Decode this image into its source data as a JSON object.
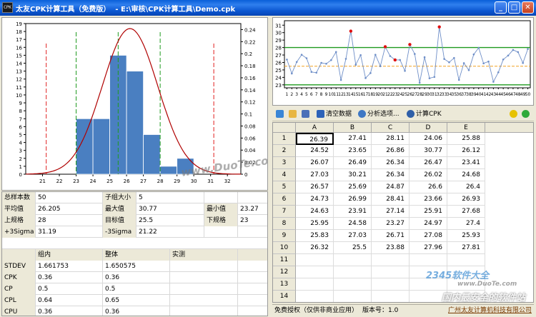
{
  "window": {
    "icon_text": "CPK",
    "title": "太友CPK计算工具（免费版）  - E:\\审核\\CPK计算工具\\Demo.cpk",
    "min": "_",
    "max": "□",
    "close": "✕"
  },
  "histogram": {
    "y_left_ticks": [
      "0",
      "1",
      "2",
      "3",
      "4",
      "5",
      "6",
      "7",
      "8",
      "9",
      "10",
      "11",
      "12",
      "13",
      "14",
      "15",
      "16",
      "17",
      "18",
      "19"
    ],
    "y_right_ticks": [
      "0",
      "0.02",
      "0.04",
      "0.06",
      "0.08",
      "0.1",
      "0.12",
      "0.14",
      "0.16",
      "0.18",
      "0.2",
      "0.22",
      "0.24"
    ],
    "x_ticks": [
      "21",
      "22",
      "23",
      "24",
      "25",
      "26",
      "27",
      "28",
      "29",
      "30",
      "31",
      "32"
    ],
    "watermark": "www.DuoTe.com"
  },
  "control_chart": {
    "y_ticks": [
      "23",
      "24",
      "25",
      "26",
      "27",
      "28",
      "29",
      "30",
      "31"
    ],
    "x_ticks": [
      "1",
      "2",
      "3",
      "4",
      "5",
      "6",
      "7",
      "8",
      "9",
      "10",
      "11",
      "12",
      "13",
      "14",
      "15",
      "16",
      "17",
      "18",
      "19",
      "20",
      "21",
      "22",
      "23",
      "24",
      "25",
      "26",
      "27",
      "28",
      "29",
      "30",
      "31",
      "32",
      "33",
      "34",
      "35",
      "36",
      "37",
      "38",
      "39",
      "40",
      "41",
      "42",
      "43",
      "44",
      "45",
      "46",
      "47",
      "48",
      "49",
      "50"
    ]
  },
  "chart_data": [
    {
      "type": "bar",
      "categories": [
        "23-24",
        "24-25",
        "25-26",
        "26-27",
        "27-28",
        "28-29",
        "29-30",
        "30-31"
      ],
      "values": [
        7,
        7,
        15,
        13,
        5,
        1,
        2,
        0
      ],
      "title": "",
      "xlabel": "",
      "ylabel": "",
      "ylim": [
        0,
        19
      ],
      "y2lim": [
        0,
        0.25
      ],
      "lsl": 21.22,
      "usl": 31.19,
      "spec_lines": [
        23,
        25.5,
        28
      ],
      "mean": 26.205,
      "stdev": 1.650575,
      "xlim": [
        20,
        32.8
      ]
    },
    {
      "type": "line",
      "x": [
        1,
        2,
        3,
        4,
        5,
        6,
        7,
        8,
        9,
        10,
        11,
        12,
        13,
        14,
        15,
        16,
        17,
        18,
        19,
        20,
        21,
        22,
        23,
        24,
        25,
        26,
        27,
        28,
        29,
        30,
        31,
        32,
        33,
        34,
        35,
        36,
        37,
        38,
        39,
        40,
        41,
        42,
        43,
        44,
        45,
        46,
        47,
        48,
        49,
        50
      ],
      "values": [
        26.39,
        24.52,
        26.07,
        27.03,
        26.57,
        24.73,
        24.63,
        25.95,
        25.83,
        26.32,
        27.41,
        23.65,
        26.49,
        30.21,
        25.69,
        26.99,
        23.91,
        24.58,
        27.03,
        25.5,
        28.11,
        26.86,
        26.34,
        26.34,
        24.87,
        28.41,
        27.14,
        23.27,
        26.71,
        23.88,
        24.06,
        30.77,
        26.47,
        26.02,
        26.6,
        23.66,
        25.91,
        24.97,
        27.08,
        27.96,
        25.88,
        26.12,
        23.41,
        24.68,
        26.4,
        26.93,
        27.68,
        27.4,
        25.93,
        27.81
      ],
      "ylim": [
        22.6,
        31.6
      ],
      "usl": 28,
      "lsl": 23,
      "center": 25.5,
      "highlight_points": [
        14,
        21,
        23,
        26,
        32
      ]
    }
  ],
  "stats": {
    "row1": [
      "总样本数",
      "50",
      "子组大小",
      "5"
    ],
    "row2": [
      "平均值",
      "26.205",
      "最大值",
      "30.77",
      "最小值",
      "23.27"
    ],
    "row3": [
      "上规格",
      "28",
      "目标值",
      "25.5",
      "下规格",
      "23"
    ],
    "row4": [
      "+3Sigma",
      "31.19",
      "-3Sigma",
      "21.22"
    ],
    "cap_header": [
      "",
      "组内",
      "整体",
      "实测"
    ],
    "cap_rows": [
      [
        "STDEV",
        "1.661753",
        "1.650575",
        ""
      ],
      [
        "CPK",
        "0.36",
        "0.36",
        ""
      ],
      [
        "CP",
        "0.5",
        "0.5",
        ""
      ],
      [
        "CPL",
        "0.64",
        "0.65",
        ""
      ],
      [
        "CPU",
        "0.36",
        "0.36",
        ""
      ]
    ]
  },
  "toolbar": {
    "clear": "清空数据",
    "options": "分析选项...",
    "calc": "计算CPK"
  },
  "grid": {
    "columns": [
      "A",
      "B",
      "C",
      "D",
      "E"
    ],
    "rows": [
      {
        "n": "1",
        "v": [
          "26.39",
          "27.41",
          "28.11",
          "24.06",
          "25.88"
        ]
      },
      {
        "n": "2",
        "v": [
          "24.52",
          "23.65",
          "26.86",
          "30.77",
          "26.12"
        ]
      },
      {
        "n": "3",
        "v": [
          "26.07",
          "26.49",
          "26.34",
          "26.47",
          "23.41"
        ]
      },
      {
        "n": "4",
        "v": [
          "27.03",
          "30.21",
          "26.34",
          "26.02",
          "24.68"
        ]
      },
      {
        "n": "5",
        "v": [
          "26.57",
          "25.69",
          "24.87",
          "26.6",
          "26.4"
        ]
      },
      {
        "n": "6",
        "v": [
          "24.73",
          "26.99",
          "28.41",
          "23.66",
          "26.93"
        ]
      },
      {
        "n": "7",
        "v": [
          "24.63",
          "23.91",
          "27.14",
          "25.91",
          "27.68"
        ]
      },
      {
        "n": "8",
        "v": [
          "25.95",
          "24.58",
          "23.27",
          "24.97",
          "27.4"
        ]
      },
      {
        "n": "9",
        "v": [
          "25.83",
          "27.03",
          "26.71",
          "27.08",
          "25.93"
        ]
      },
      {
        "n": "10",
        "v": [
          "26.32",
          "25.5",
          "23.88",
          "27.96",
          "27.81"
        ]
      },
      {
        "n": "11",
        "v": [
          "",
          "",
          "",
          "",
          ""
        ]
      },
      {
        "n": "12",
        "v": [
          "",
          "",
          "",
          "",
          ""
        ]
      },
      {
        "n": "13",
        "v": [
          "",
          "",
          "",
          "",
          ""
        ]
      },
      {
        "n": "14",
        "v": [
          "",
          "",
          "",
          "",
          ""
        ]
      }
    ]
  },
  "statusbar": {
    "license": "免费授权（仅供非商业应用）",
    "version": "版本号：1.0",
    "company": "广州太友计算机科技有限公司"
  },
  "watermark2": {
    "brand": "2345软件大全",
    "url": "www.DuoTe.com",
    "slogan": "国内最安全的软件站"
  },
  "colors": {
    "bar": "#4a7fc1",
    "curve": "#b00000",
    "spec_red": "#e02020",
    "spec_green": "#1e9a1e",
    "line": "#6f8fc8",
    "center": "#f0a020"
  }
}
